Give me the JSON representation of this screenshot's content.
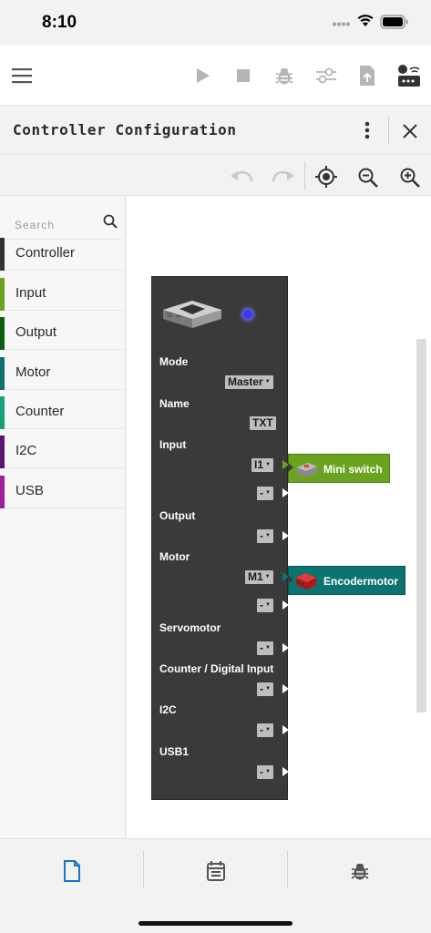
{
  "status_bar": {
    "time": "8:10"
  },
  "title_bar": {
    "title": "Controller Configuration"
  },
  "sidebar": {
    "search_placeholder": "Search",
    "categories": [
      {
        "label": "Controller",
        "color": "#333333"
      },
      {
        "label": "Input",
        "color": "#6aa31e"
      },
      {
        "label": "Output",
        "color": "#0f5e0f"
      },
      {
        "label": "Motor",
        "color": "#0d7370"
      },
      {
        "label": "Counter",
        "color": "#17a07a"
      },
      {
        "label": "I2C",
        "color": "#5a1570"
      },
      {
        "label": "USB",
        "color": "#9c1f9c"
      }
    ]
  },
  "controller_block": {
    "mode_label": "Mode",
    "mode_value": "Master",
    "name_label": "Name",
    "name_value": "TXT",
    "input_label": "Input",
    "input_slot1": "I1",
    "input_slot2": "-",
    "output_label": "Output",
    "output_slot1": "-",
    "motor_label": "Motor",
    "motor_slot1": "M1",
    "motor_slot2": "-",
    "servo_label": "Servomotor",
    "servo_slot1": "-",
    "counter_label": "Counter / Digital Input",
    "counter_slot1": "-",
    "i2c_label": "I2C",
    "i2c_slot1": "-",
    "usb_label": "USB1",
    "usb_slot1": "-"
  },
  "attached_blocks": [
    {
      "label": "Mini switch",
      "color": "#6aa31e"
    },
    {
      "label": "Encodermotor",
      "color": "#0d7370"
    }
  ],
  "colors": {
    "accent": "#1a73c9",
    "icon_gray": "#b5b5b5",
    "icon_dark": "#333333"
  }
}
